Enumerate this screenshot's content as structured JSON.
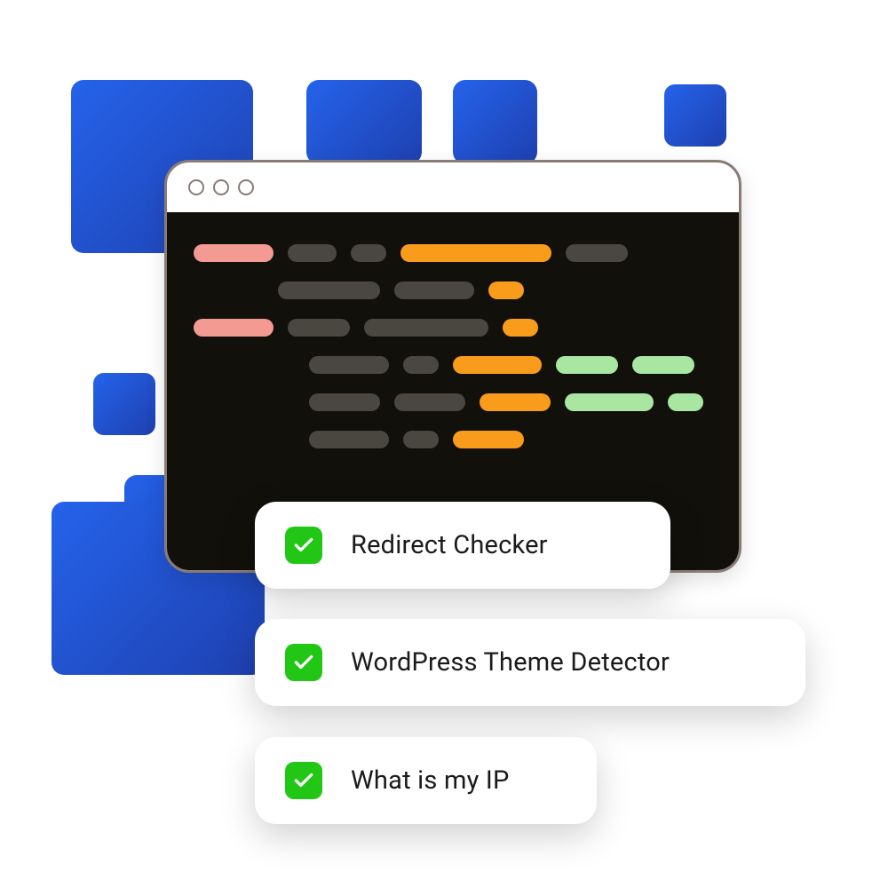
{
  "features": [
    {
      "label": "Redirect Checker"
    },
    {
      "label": "WordPress Theme Detector"
    },
    {
      "label": "What is my IP"
    }
  ]
}
